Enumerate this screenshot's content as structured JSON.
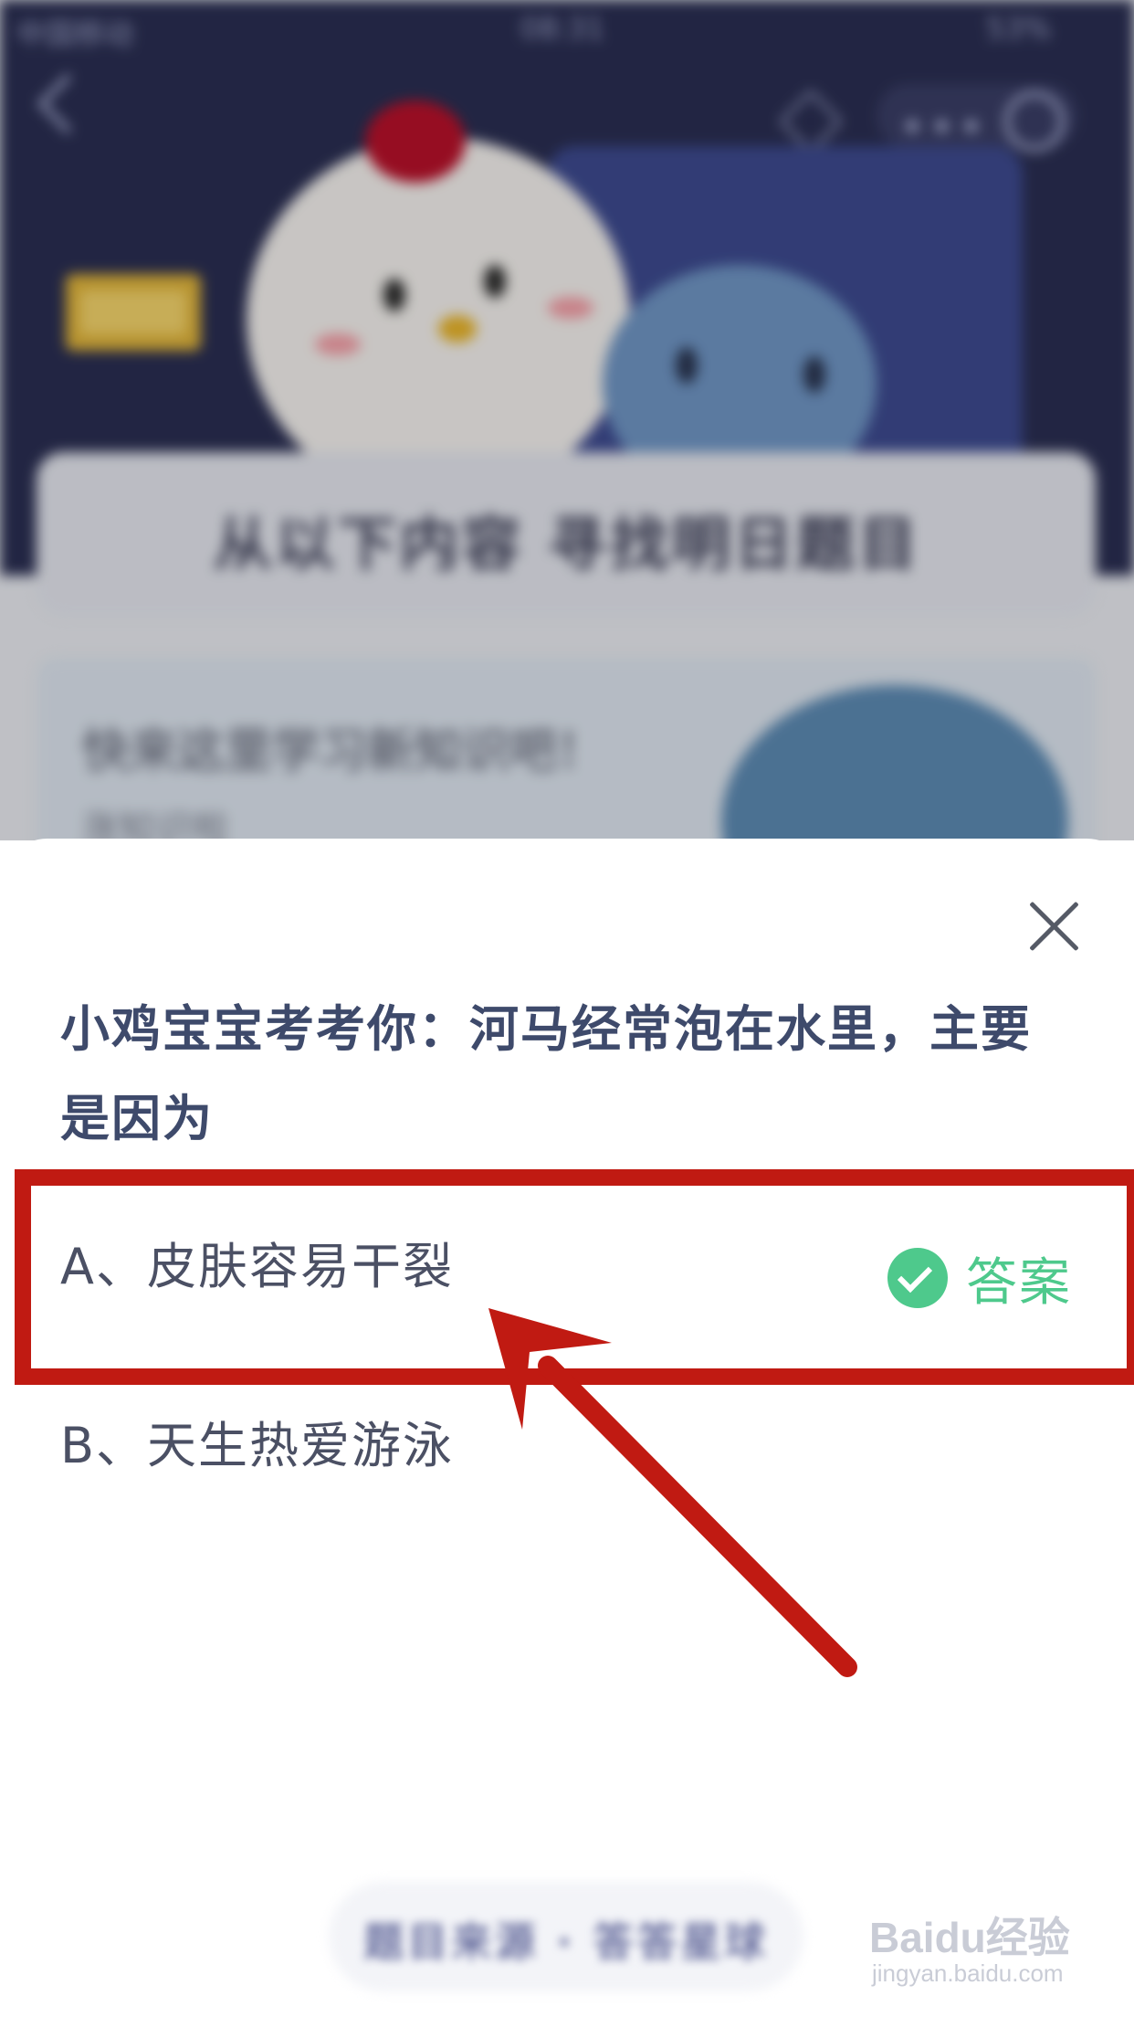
{
  "status_bar": {
    "carrier": "中国移动",
    "time": "08:31",
    "battery": "53%"
  },
  "background": {
    "title": "从以下内容 寻找明日题目",
    "card_text": "快来这里学习新知识吧！",
    "card_sub": "涨知识啦"
  },
  "quiz": {
    "question": "小鸡宝宝考考你：河马经常泡在水里，主要是因为",
    "options": [
      {
        "label": "A、皮肤容易干裂"
      },
      {
        "label": "B、天生热爱游泳"
      }
    ],
    "answer_label": "答案"
  },
  "bottom_button": {
    "label": "题目来源 · 答答星球"
  },
  "watermark": {
    "brand": "Baidu经验",
    "url": "jingyan.baidu.com"
  },
  "colors": {
    "accent_green": "#4ec98c",
    "annotation_red": "#c01a12",
    "question_text": "#3e4a6b"
  }
}
